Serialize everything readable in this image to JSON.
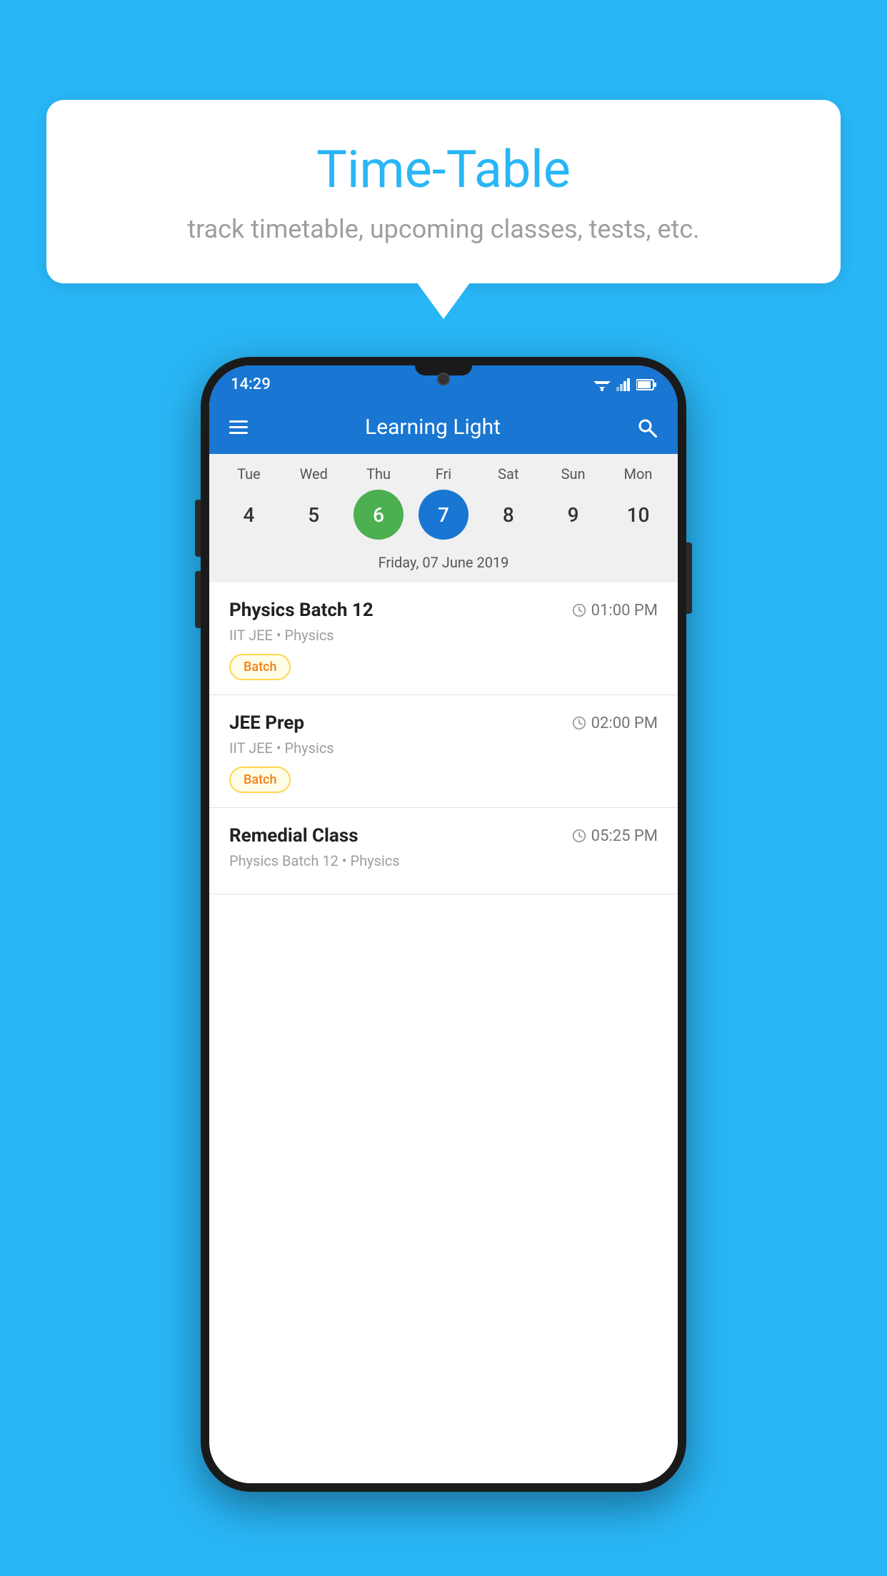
{
  "background_color": "#29B6F6",
  "bubble": {
    "title": "Time-Table",
    "subtitle": "track timetable, upcoming classes, tests, etc."
  },
  "phone": {
    "status_bar": {
      "time": "14:29",
      "wifi": true,
      "signal": true,
      "battery": true
    },
    "app_bar": {
      "title": "Learning Light",
      "menu_icon": "hamburger-icon",
      "search_icon": "search-icon"
    },
    "calendar": {
      "days": [
        "Tue",
        "Wed",
        "Thu",
        "Fri",
        "Sat",
        "Sun",
        "Mon"
      ],
      "dates": [
        4,
        5,
        6,
        7,
        8,
        9,
        10
      ],
      "today_index": 2,
      "selected_index": 3,
      "selected_date_label": "Friday, 07 June 2019"
    },
    "schedule": [
      {
        "title": "Physics Batch 12",
        "time": "01:00 PM",
        "subtitle": "IIT JEE • Physics",
        "badge": "Batch"
      },
      {
        "title": "JEE Prep",
        "time": "02:00 PM",
        "subtitle": "IIT JEE • Physics",
        "badge": "Batch"
      },
      {
        "title": "Remedial Class",
        "time": "05:25 PM",
        "subtitle": "Physics Batch 12 • Physics",
        "badge": null
      }
    ]
  }
}
